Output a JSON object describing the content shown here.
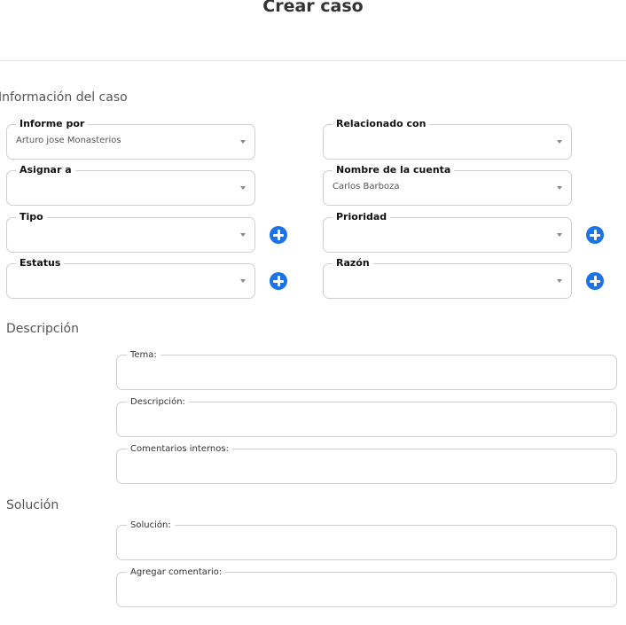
{
  "header": {
    "title": "Crear caso"
  },
  "sections": {
    "case_info": "Información del caso",
    "description": "Descripción",
    "solution": "Solución"
  },
  "case_fields": {
    "informe_por": {
      "label": "Informe por",
      "value": "Arturo jose Monasterios"
    },
    "relacionado_con": {
      "label": "Relacionado con",
      "value": ""
    },
    "asignar_a": {
      "label": "Asignar a",
      "value": ""
    },
    "nombre_cuenta": {
      "label": "Nombre de la cuenta",
      "value": "Carlos Barboza"
    },
    "tipo": {
      "label": "Tipo",
      "value": ""
    },
    "prioridad": {
      "label": "Prioridad",
      "value": ""
    },
    "estatus": {
      "label": "Estatus",
      "value": ""
    },
    "razon": {
      "label": "Razón",
      "value": ""
    }
  },
  "description_fields": {
    "tema": {
      "label": "Tema:",
      "value": ""
    },
    "descripcion": {
      "label": "Descripción:",
      "value": ""
    },
    "comentarios_internos": {
      "label": "Comentarios internos:",
      "value": ""
    }
  },
  "solution_fields": {
    "solucion": {
      "label": "Solución:",
      "value": ""
    },
    "agregar_comentario": {
      "label": "Agregar comentario:",
      "value": ""
    }
  },
  "icons": {
    "add": "plus-circle-icon",
    "dropdown": "chevron-down-icon"
  },
  "colors": {
    "accent": "#1a73e8",
    "border": "#cfcfcf"
  }
}
